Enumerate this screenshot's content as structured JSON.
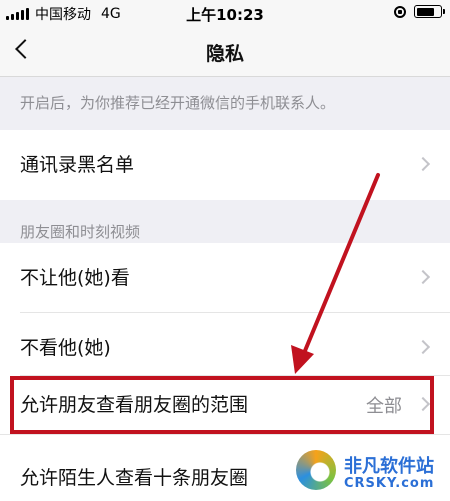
{
  "status_bar": {
    "carrier": "中国移动",
    "network": "4G",
    "time": "上午10:23",
    "battery_level": 0.8
  },
  "nav": {
    "title": "隐私"
  },
  "hint_text": "开启后，为你推荐已经开通微信的手机联系人。",
  "rows": {
    "blacklist": {
      "label": "通讯录黑名单"
    },
    "hide_from": {
      "label": "不让他(她)看"
    },
    "dont_view": {
      "label": "不看他(她)"
    },
    "moments_range": {
      "label": "允许朋友查看朋友圈的范围",
      "value": "全部"
    },
    "stranger_ten": {
      "label": "允许陌生人查看十条朋友圈"
    }
  },
  "section_header": "朋友圈和时刻视频",
  "watermark": {
    "top": "非凡软件站",
    "bottom": "CRSKY.com"
  },
  "colors": {
    "annotation_red": "#c1121f",
    "background": "#efeff4",
    "secondary_text": "#8e8e93"
  }
}
